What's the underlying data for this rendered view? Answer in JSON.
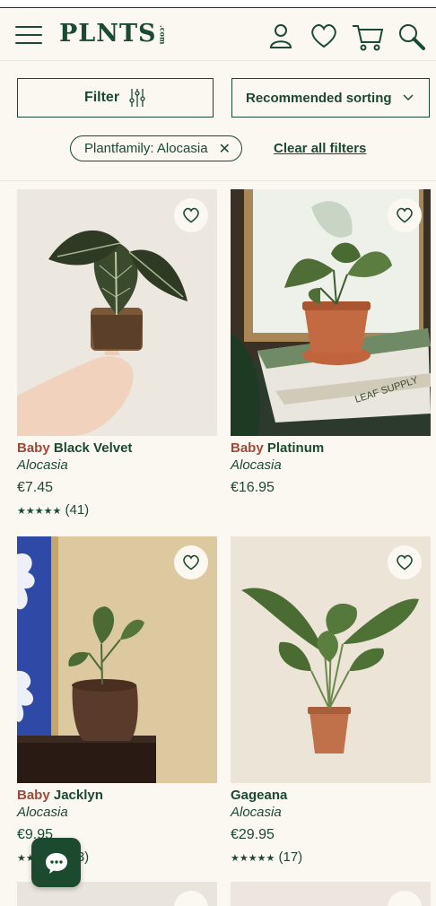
{
  "header": {
    "logo": "PLNTS",
    "logo_suffix": ".com",
    "icons": [
      "menu-icon",
      "account-icon",
      "wishlist-icon",
      "cart-icon",
      "search-icon"
    ]
  },
  "filters": {
    "filter_label": "Filter",
    "sort_label": "Recommended sorting",
    "chip_label": "Plantfamily: Alocasia",
    "chip_remove": "✕",
    "clear_all": "Clear all filters"
  },
  "products": [
    {
      "prefix": "Baby",
      "name": "Black Velvet",
      "genus": "Alocasia",
      "price": "€7.45",
      "stars": "★★★★★",
      "reviews": "(41)"
    },
    {
      "prefix": "Baby",
      "name": "Platinum",
      "genus": "Alocasia",
      "price": "€16.95"
    },
    {
      "prefix": "Baby",
      "name": "Jacklyn",
      "genus": "Alocasia",
      "price": "€9.95",
      "stars": "★★★★★",
      "reviews": "(13)"
    },
    {
      "prefix": "",
      "name": "Gageana",
      "genus": "Alocasia",
      "price": "€29.95",
      "stars": "★★★★★",
      "reviews": "(17)"
    }
  ],
  "product_image_text": "LEAF SUPPLY",
  "colors": {
    "brand_green": "#1c4a2e",
    "baby_red": "#9b4a3a",
    "background": "#fbf8f1"
  }
}
